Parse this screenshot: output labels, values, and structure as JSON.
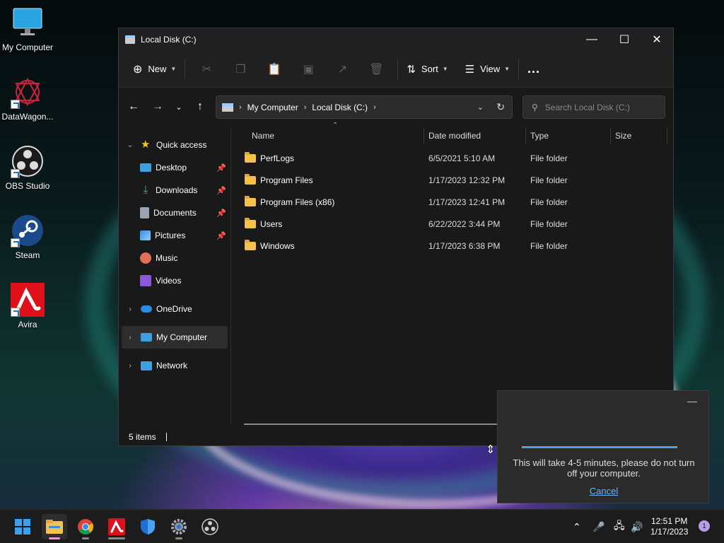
{
  "desktop": {
    "icons": [
      {
        "label": "My Computer"
      },
      {
        "label": "DataWagon..."
      },
      {
        "label": "OBS Studio"
      },
      {
        "label": "Steam"
      },
      {
        "label": "Avira"
      }
    ]
  },
  "window": {
    "title": "Local Disk (C:)",
    "toolbar": {
      "new_label": "New",
      "sort_label": "Sort",
      "view_label": "View",
      "more_label": "..."
    },
    "address": {
      "crumbs": [
        "My Computer",
        "Local Disk (C:)"
      ]
    },
    "search": {
      "placeholder": "Search Local Disk (C:)"
    },
    "sidebar": {
      "items": [
        {
          "label": "Quick access",
          "icon": "star-icon"
        },
        {
          "label": "Desktop",
          "icon": "desktop-icon"
        },
        {
          "label": "Downloads",
          "icon": "download-icon"
        },
        {
          "label": "Documents",
          "icon": "documents-icon"
        },
        {
          "label": "Pictures",
          "icon": "pictures-icon"
        },
        {
          "label": "Music",
          "icon": "music-icon"
        },
        {
          "label": "Videos",
          "icon": "videos-icon"
        },
        {
          "label": "OneDrive",
          "icon": "cloud-icon"
        },
        {
          "label": "My Computer",
          "icon": "computer-icon"
        },
        {
          "label": "Network",
          "icon": "network-icon"
        }
      ]
    },
    "columns": [
      "Name",
      "Date modified",
      "Type",
      "Size"
    ],
    "files": [
      {
        "name": "PerfLogs",
        "date": "6/5/2021 5:10 AM",
        "type": "File folder"
      },
      {
        "name": "Program Files",
        "date": "1/17/2023 12:32 PM",
        "type": "File folder"
      },
      {
        "name": "Program Files (x86)",
        "date": "1/17/2023 12:41 PM",
        "type": "File folder"
      },
      {
        "name": "Users",
        "date": "6/22/2022 3:44 PM",
        "type": "File folder"
      },
      {
        "name": "Windows",
        "date": "1/17/2023 6:38 PM",
        "type": "File folder"
      }
    ],
    "status": "5 items"
  },
  "notification": {
    "message": "This will take 4-5 minutes, please do not turn off your computer.",
    "cancel_label": "Cancel"
  },
  "taskbar": {
    "time": "12:51 PM",
    "date": "1/17/2023",
    "badge": "1"
  }
}
